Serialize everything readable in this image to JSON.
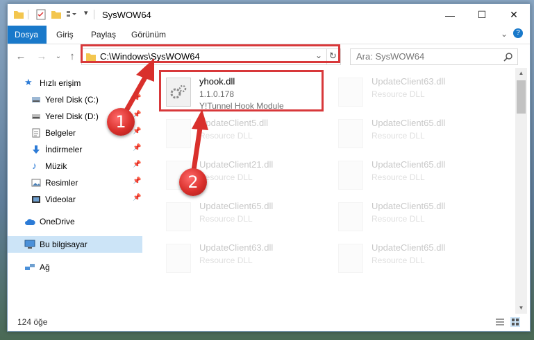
{
  "window": {
    "title": "SysWOW64",
    "minimize": "—",
    "maximize": "☐",
    "close": "✕"
  },
  "ribbon": {
    "tabs": [
      "Dosya",
      "Giriş",
      "Paylaş",
      "Görünüm"
    ]
  },
  "address": {
    "path": "C:\\Windows\\SysWOW64",
    "search_placeholder": "Ara: SysWOW64"
  },
  "sidebar": {
    "items": [
      {
        "label": "Hızlı erişim",
        "icon": "star-icon"
      },
      {
        "label": "Yerel Disk (C:)",
        "icon": "drive-icon"
      },
      {
        "label": "Yerel Disk (D:)",
        "icon": "drive-icon"
      },
      {
        "label": "Belgeler",
        "icon": "documents-icon"
      },
      {
        "label": "İndirmeler",
        "icon": "download-icon"
      },
      {
        "label": "Müzik",
        "icon": "music-icon"
      },
      {
        "label": "Resimler",
        "icon": "pictures-icon"
      },
      {
        "label": "Videolar",
        "icon": "videos-icon"
      },
      {
        "label": "OneDrive",
        "icon": "cloud-icon"
      },
      {
        "label": "Bu bilgisayar",
        "icon": "computer-icon"
      },
      {
        "label": "Ağ",
        "icon": "network-icon"
      }
    ]
  },
  "files": {
    "main": {
      "name": "yhook.dll",
      "version": "1.1.0.178",
      "description": "Y!Tunnel Hook Module"
    },
    "faded": [
      {
        "name": "UpdateClient63.dll",
        "description": "Resource DLL"
      },
      {
        "name": "UpdateClient5.dll",
        "description": "Resource DLL"
      },
      {
        "name": "UpdateClient65.dll",
        "description": "Resource DLL"
      },
      {
        "name": "UpdateClient21.dll",
        "description": "Resource DLL"
      },
      {
        "name": "UpdateClient65.dll",
        "description": "Resource DLL"
      },
      {
        "name": "UpdateClient65.dll",
        "description": "Resource DLL"
      },
      {
        "name": "UpdateClient65.dll",
        "description": "Resource DLL"
      },
      {
        "name": "UpdateClient63.dll",
        "description": "Resource DLL"
      },
      {
        "name": "UpdateClient65.dll",
        "description": "Resource DLL"
      }
    ]
  },
  "status": {
    "count": "124 öğe"
  },
  "annotations": {
    "step1": "1",
    "step2": "2"
  },
  "colors": {
    "accent": "#1979ca",
    "highlight": "#d8383a",
    "selected": "#cce4f7"
  }
}
